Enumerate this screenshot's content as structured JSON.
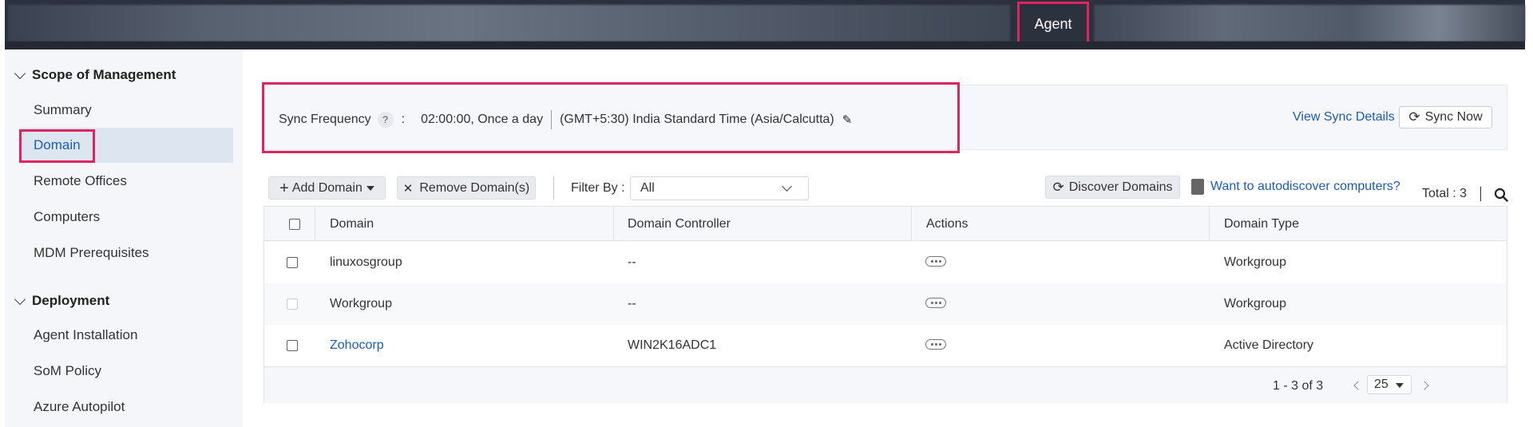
{
  "topbar": {
    "active_tab": "Agent"
  },
  "sidebar": {
    "sections": [
      {
        "title": "Scope of Management",
        "items": [
          "Summary",
          "Domain",
          "Remote Offices",
          "Computers",
          "MDM Prerequisites"
        ]
      },
      {
        "title": "Deployment",
        "items": [
          "Agent Installation",
          "SoM Policy",
          "Azure Autopilot"
        ]
      }
    ],
    "active_item": "Domain"
  },
  "sync": {
    "label": "Sync Frequency",
    "help": "?",
    "colon": ":",
    "frequency": "02:00:00, Once a day",
    "timezone": "(GMT+5:30) India Standard Time (Asia/Calcutta)",
    "view_details": "View Sync Details",
    "sync_now": "Sync Now"
  },
  "toolbar": {
    "add_domain": "Add Domain",
    "remove_domain": "Remove Domain(s)",
    "filter_label": "Filter By :",
    "filter_value": "All",
    "discover": "Discover Domains",
    "autodiscover_link": "Want to autodiscover computers?",
    "total": "Total : 3"
  },
  "table": {
    "columns": [
      "Domain",
      "Domain Controller",
      "Actions",
      "Domain Type"
    ],
    "rows": [
      {
        "domain": "linuxosgroup",
        "controller": "--",
        "type": "Workgroup",
        "link": false,
        "checkbox_disabled": false
      },
      {
        "domain": "Workgroup",
        "controller": "--",
        "type": "Workgroup",
        "link": false,
        "checkbox_disabled": true
      },
      {
        "domain": "Zohocorp",
        "controller": "WIN2K16ADC1",
        "type": "Active Directory",
        "link": true,
        "checkbox_disabled": false
      }
    ],
    "pagination": {
      "info": "1 - 3 of 3",
      "page_size": "25"
    }
  },
  "colors": {
    "accent": "#1b5bbf",
    "highlight": "#e0245e",
    "topbar": "#2b313d"
  },
  "icons": [
    "chevron-down-icon",
    "help-icon",
    "pencil-icon",
    "refresh-icon",
    "plus-icon",
    "close-icon",
    "caret-down-icon",
    "autodiscover-icon",
    "search-icon",
    "more-actions-icon",
    "chevron-left-icon",
    "chevron-right-icon"
  ]
}
